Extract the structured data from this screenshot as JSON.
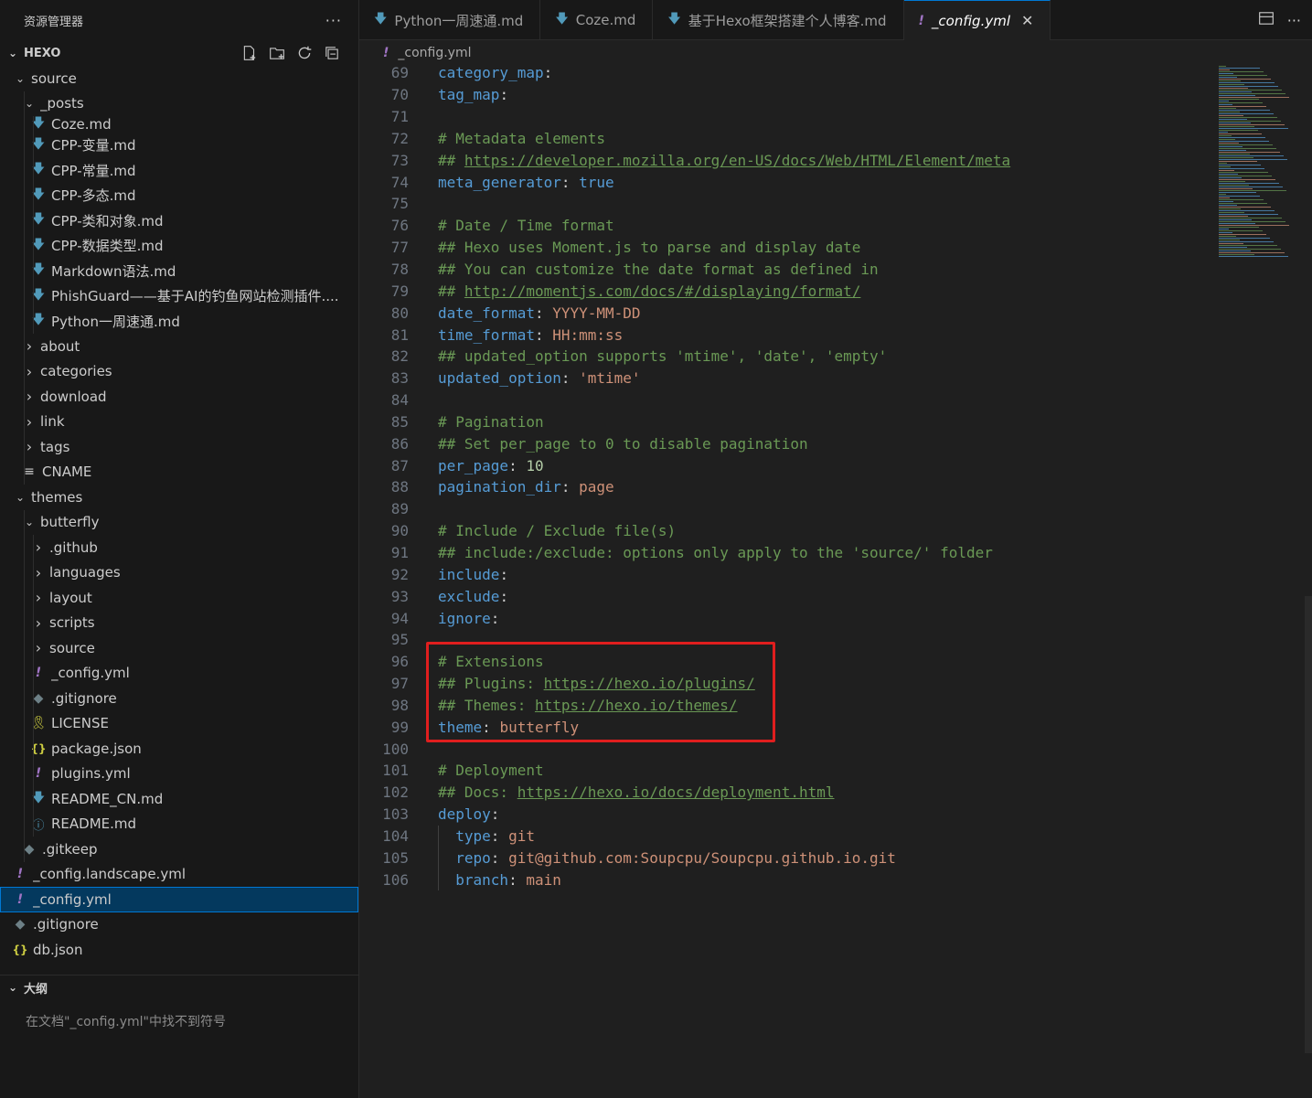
{
  "explorer": {
    "title": "资源管理器",
    "more": "···",
    "workspace": "HEXO"
  },
  "tree": [
    {
      "label": "source",
      "depth": 1,
      "kind": "folder-open"
    },
    {
      "label": "_posts",
      "depth": 2,
      "kind": "folder-open"
    },
    {
      "label": "Coze.md",
      "depth": 3,
      "kind": "md"
    },
    {
      "label": "CPP-变量.md",
      "depth": 3,
      "kind": "md"
    },
    {
      "label": "CPP-常量.md",
      "depth": 3,
      "kind": "md"
    },
    {
      "label": "CPP-多态.md",
      "depth": 3,
      "kind": "md"
    },
    {
      "label": "CPP-类和对象.md",
      "depth": 3,
      "kind": "md"
    },
    {
      "label": "CPP-数据类型.md",
      "depth": 3,
      "kind": "md"
    },
    {
      "label": "Markdown语法.md",
      "depth": 3,
      "kind": "md"
    },
    {
      "label": "PhishGuard——基于AI的钓鱼网站检测插件....",
      "depth": 3,
      "kind": "md"
    },
    {
      "label": "Python一周速通.md",
      "depth": 3,
      "kind": "md"
    },
    {
      "label": "about",
      "depth": 2,
      "kind": "folder"
    },
    {
      "label": "categories",
      "depth": 2,
      "kind": "folder"
    },
    {
      "label": "download",
      "depth": 2,
      "kind": "folder"
    },
    {
      "label": "link",
      "depth": 2,
      "kind": "folder"
    },
    {
      "label": "tags",
      "depth": 2,
      "kind": "folder"
    },
    {
      "label": "CNAME",
      "depth": 2,
      "kind": "cname"
    },
    {
      "label": "themes",
      "depth": 1,
      "kind": "folder-open"
    },
    {
      "label": "butterfly",
      "depth": 2,
      "kind": "folder-open"
    },
    {
      "label": ".github",
      "depth": 3,
      "kind": "folder"
    },
    {
      "label": "languages",
      "depth": 3,
      "kind": "folder"
    },
    {
      "label": "layout",
      "depth": 3,
      "kind": "folder"
    },
    {
      "label": "scripts",
      "depth": 3,
      "kind": "folder"
    },
    {
      "label": "source",
      "depth": 3,
      "kind": "folder"
    },
    {
      "label": "_config.yml",
      "depth": 3,
      "kind": "yml"
    },
    {
      "label": ".gitignore",
      "depth": 3,
      "kind": "git"
    },
    {
      "label": "LICENSE",
      "depth": 3,
      "kind": "license"
    },
    {
      "label": "package.json",
      "depth": 3,
      "kind": "json"
    },
    {
      "label": "plugins.yml",
      "depth": 3,
      "kind": "yml"
    },
    {
      "label": "README_CN.md",
      "depth": 3,
      "kind": "md"
    },
    {
      "label": "README.md",
      "depth": 3,
      "kind": "info"
    },
    {
      "label": ".gitkeep",
      "depth": 2,
      "kind": "git"
    },
    {
      "label": "_config.landscape.yml",
      "depth": 1,
      "kind": "yml"
    },
    {
      "label": "_config.yml",
      "depth": 1,
      "kind": "yml",
      "selected": true
    },
    {
      "label": ".gitignore",
      "depth": 1,
      "kind": "git"
    },
    {
      "label": "db.json",
      "depth": 1,
      "kind": "json"
    }
  ],
  "outline": {
    "title": "大纲",
    "message": "在文档\"_config.yml\"中找不到符号"
  },
  "tabs": [
    {
      "label": "Python一周速通.md",
      "kind": "md",
      "active": false
    },
    {
      "label": "Coze.md",
      "kind": "md",
      "active": false
    },
    {
      "label": "基于Hexo框架搭建个人博客.md",
      "kind": "md",
      "active": false
    },
    {
      "label": "_config.yml",
      "kind": "yml",
      "active": true,
      "close": "✕"
    }
  ],
  "breadcrumb": {
    "file": "_config.yml"
  },
  "code_lines": [
    {
      "n": "69",
      "t": [
        [
          "k",
          "category_map"
        ],
        [
          "p",
          ":"
        ]
      ]
    },
    {
      "n": "70",
      "t": [
        [
          "k",
          "tag_map"
        ],
        [
          "p",
          ":"
        ]
      ]
    },
    {
      "n": "71",
      "t": []
    },
    {
      "n": "72",
      "t": [
        [
          "c",
          "# Metadata elements"
        ]
      ]
    },
    {
      "n": "73",
      "t": [
        [
          "c",
          "## "
        ],
        [
          "u",
          "https://developer.mozilla.org/en-US/docs/Web/HTML/Element/meta"
        ]
      ]
    },
    {
      "n": "74",
      "t": [
        [
          "k",
          "meta_generator"
        ],
        [
          "p",
          ": "
        ],
        [
          "b",
          "true"
        ]
      ]
    },
    {
      "n": "75",
      "t": []
    },
    {
      "n": "76",
      "t": [
        [
          "c",
          "# Date / Time format"
        ]
      ]
    },
    {
      "n": "77",
      "t": [
        [
          "c",
          "## Hexo uses Moment.js to parse and display date"
        ]
      ]
    },
    {
      "n": "78",
      "t": [
        [
          "c",
          "## You can customize the date format as defined in"
        ]
      ]
    },
    {
      "n": "79",
      "t": [
        [
          "c",
          "## "
        ],
        [
          "u",
          "http://momentjs.com/docs/#/displaying/format/"
        ]
      ]
    },
    {
      "n": "80",
      "t": [
        [
          "k",
          "date_format"
        ],
        [
          "p",
          ": "
        ],
        [
          "v",
          "YYYY-MM-DD"
        ]
      ]
    },
    {
      "n": "81",
      "t": [
        [
          "k",
          "time_format"
        ],
        [
          "p",
          ": "
        ],
        [
          "v",
          "HH:mm:ss"
        ]
      ]
    },
    {
      "n": "82",
      "t": [
        [
          "c",
          "## updated_option supports 'mtime', 'date', 'empty'"
        ]
      ]
    },
    {
      "n": "83",
      "t": [
        [
          "k",
          "updated_option"
        ],
        [
          "p",
          ": "
        ],
        [
          "v",
          "'mtime'"
        ]
      ]
    },
    {
      "n": "84",
      "t": []
    },
    {
      "n": "85",
      "t": [
        [
          "c",
          "# Pagination"
        ]
      ]
    },
    {
      "n": "86",
      "t": [
        [
          "c",
          "## Set per_page to 0 to disable pagination"
        ]
      ]
    },
    {
      "n": "87",
      "t": [
        [
          "k",
          "per_page"
        ],
        [
          "p",
          ": "
        ],
        [
          "n",
          "10"
        ]
      ]
    },
    {
      "n": "88",
      "t": [
        [
          "k",
          "pagination_dir"
        ],
        [
          "p",
          ": "
        ],
        [
          "v",
          "page"
        ]
      ]
    },
    {
      "n": "89",
      "t": []
    },
    {
      "n": "90",
      "t": [
        [
          "c",
          "# Include / Exclude file(s)"
        ]
      ]
    },
    {
      "n": "91",
      "t": [
        [
          "c",
          "## include:/exclude: options only apply to the 'source/' folder"
        ]
      ]
    },
    {
      "n": "92",
      "t": [
        [
          "k",
          "include"
        ],
        [
          "p",
          ":"
        ]
      ]
    },
    {
      "n": "93",
      "t": [
        [
          "k",
          "exclude"
        ],
        [
          "p",
          ":"
        ]
      ]
    },
    {
      "n": "94",
      "t": [
        [
          "k",
          "ignore"
        ],
        [
          "p",
          ":"
        ]
      ]
    },
    {
      "n": "95",
      "t": []
    },
    {
      "n": "96",
      "t": [
        [
          "c",
          "# Extensions"
        ]
      ]
    },
    {
      "n": "97",
      "t": [
        [
          "c",
          "## Plugins: "
        ],
        [
          "u",
          "https://hexo.io/plugins/"
        ]
      ]
    },
    {
      "n": "98",
      "t": [
        [
          "c",
          "## Themes: "
        ],
        [
          "u",
          "https://hexo.io/themes/"
        ]
      ]
    },
    {
      "n": "99",
      "t": [
        [
          "k",
          "theme"
        ],
        [
          "p",
          ": "
        ],
        [
          "v",
          "butterfly"
        ]
      ]
    },
    {
      "n": "100",
      "t": []
    },
    {
      "n": "101",
      "t": [
        [
          "c",
          "# Deployment"
        ]
      ]
    },
    {
      "n": "102",
      "t": [
        [
          "c",
          "## Docs: "
        ],
        [
          "u",
          "https://hexo.io/docs/deployment.html"
        ]
      ]
    },
    {
      "n": "103",
      "t": [
        [
          "k",
          "deploy"
        ],
        [
          "p",
          ":"
        ]
      ]
    },
    {
      "n": "104",
      "t": [
        [
          "p",
          "  "
        ],
        [
          "k",
          "type"
        ],
        [
          "p",
          ": "
        ],
        [
          "v",
          "git"
        ]
      ],
      "indent": true
    },
    {
      "n": "105",
      "t": [
        [
          "p",
          "  "
        ],
        [
          "k",
          "repo"
        ],
        [
          "p",
          ": "
        ],
        [
          "v",
          "git@github.com:Soupcpu/Soupcpu.github.io.git"
        ]
      ],
      "indent": true
    },
    {
      "n": "106",
      "t": [
        [
          "p",
          "  "
        ],
        [
          "k",
          "branch"
        ],
        [
          "p",
          ": "
        ],
        [
          "v",
          "main"
        ]
      ],
      "indent": true
    }
  ],
  "colors": {
    "accent": "#0078d4",
    "highlight_box": "#e01e1e",
    "key": "#569cd6",
    "string": "#ce9178",
    "comment": "#6a9955",
    "number": "#b5cea8"
  }
}
